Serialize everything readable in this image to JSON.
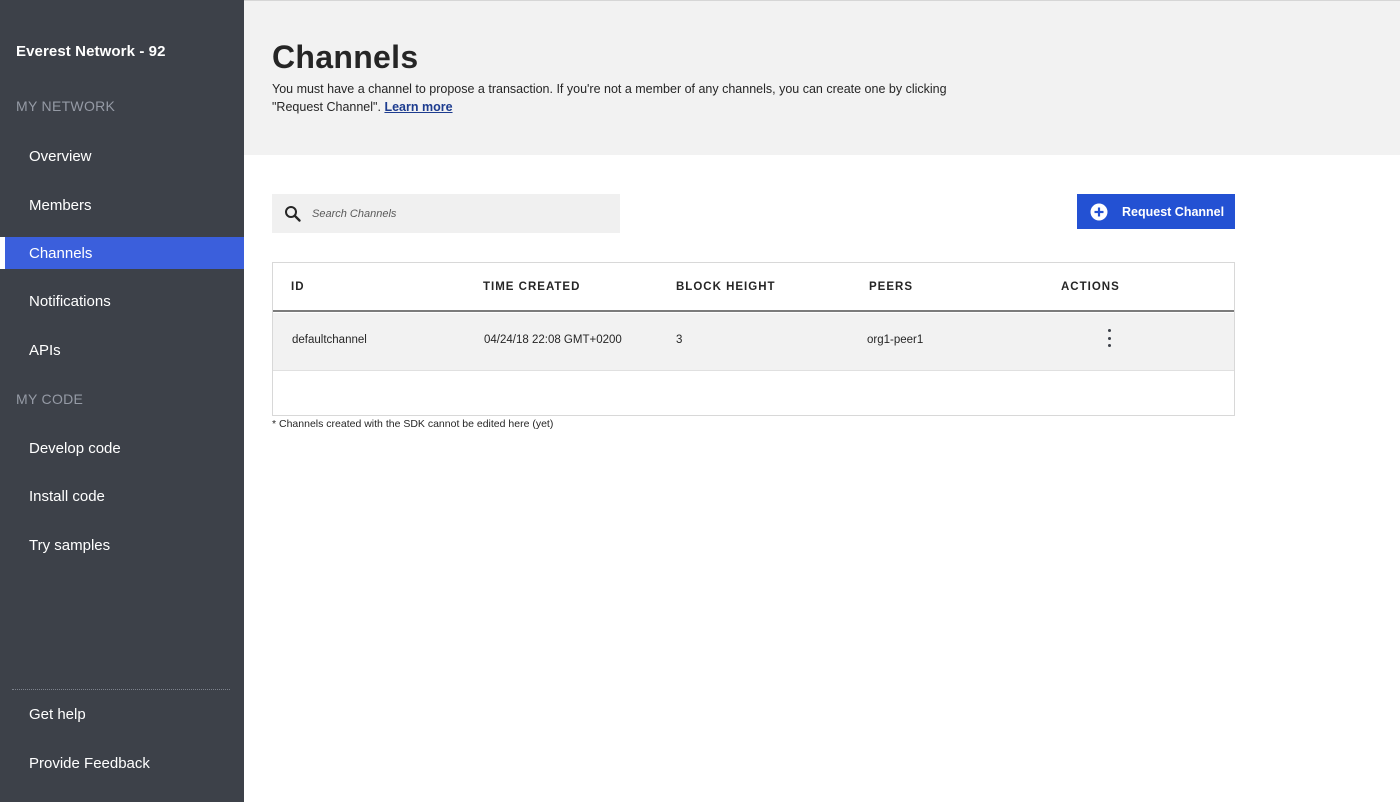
{
  "sidebar": {
    "network_name": "Everest Network - 92",
    "sections": [
      {
        "label": "MY NETWORK"
      },
      {
        "label": "MY CODE"
      }
    ],
    "items": [
      {
        "label": "Overview"
      },
      {
        "label": "Members"
      },
      {
        "label": "Channels",
        "active": true
      },
      {
        "label": "Notifications"
      },
      {
        "label": "APIs"
      },
      {
        "label": "Develop code"
      },
      {
        "label": "Install code"
      },
      {
        "label": "Try samples"
      }
    ],
    "footer_items": [
      {
        "label": "Get help"
      },
      {
        "label": "Provide Feedback"
      }
    ]
  },
  "header": {
    "title": "Channels",
    "description": "You must have a channel to propose a transaction. If you're not a member of any channels, you can create one by clicking \"Request Channel\".",
    "learn_more": "Learn more"
  },
  "search": {
    "placeholder": "Search Channels",
    "icon": "search-icon"
  },
  "request_button": {
    "label": "Request Channel",
    "icon": "add-circle-icon"
  },
  "table": {
    "columns": [
      "ID",
      "TIME CREATED",
      "BLOCK HEIGHT",
      "PEERS",
      "ACTIONS"
    ],
    "rows": [
      {
        "id": "defaultchannel",
        "time_created": "04/24/18 22:08 GMT+0200",
        "block_height": "3",
        "peers": "org1-peer1",
        "actions_icon": "overflow-menu-icon"
      }
    ]
  },
  "footnote": "* Channels created with the SDK cannot be edited here (yet)",
  "colors": {
    "sidebar_bg": "#3d4149",
    "active_item": "#3b5fdc",
    "primary_button": "#2351d3",
    "header_bg": "#f2f2f2"
  }
}
